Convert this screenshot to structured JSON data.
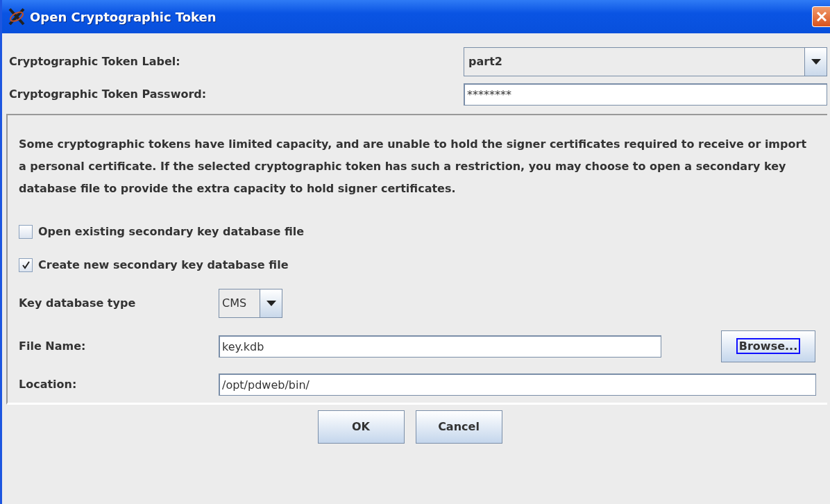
{
  "window": {
    "title": "Open Cryptographic Token"
  },
  "token": {
    "label_caption": "Cryptographic Token Label:",
    "label_value": "part2",
    "password_caption": "Cryptographic Token Password:",
    "password_value": "********"
  },
  "description": "Some cryptographic tokens have limited capacity, and are unable to hold the signer certificates required to receive or import a personal certificate.  If the selected cryptographic token has such a restriction, you may choose to open a secondary key database file to provide the extra capacity to hold signer certificates.",
  "options": [
    {
      "label": "Open existing secondary key database file",
      "checked": false
    },
    {
      "label": "Create new secondary key database file",
      "checked": true
    }
  ],
  "key_database_type": {
    "caption": "Key database type",
    "value": "CMS"
  },
  "file_name": {
    "caption": "File Name:",
    "value": "key.kdb"
  },
  "browse_button": {
    "label": "Browse...",
    "focused": true
  },
  "location": {
    "caption": "Location:",
    "value": "/opt/pdweb/bin/"
  },
  "buttons": [
    "OK",
    "Cancel"
  ]
}
